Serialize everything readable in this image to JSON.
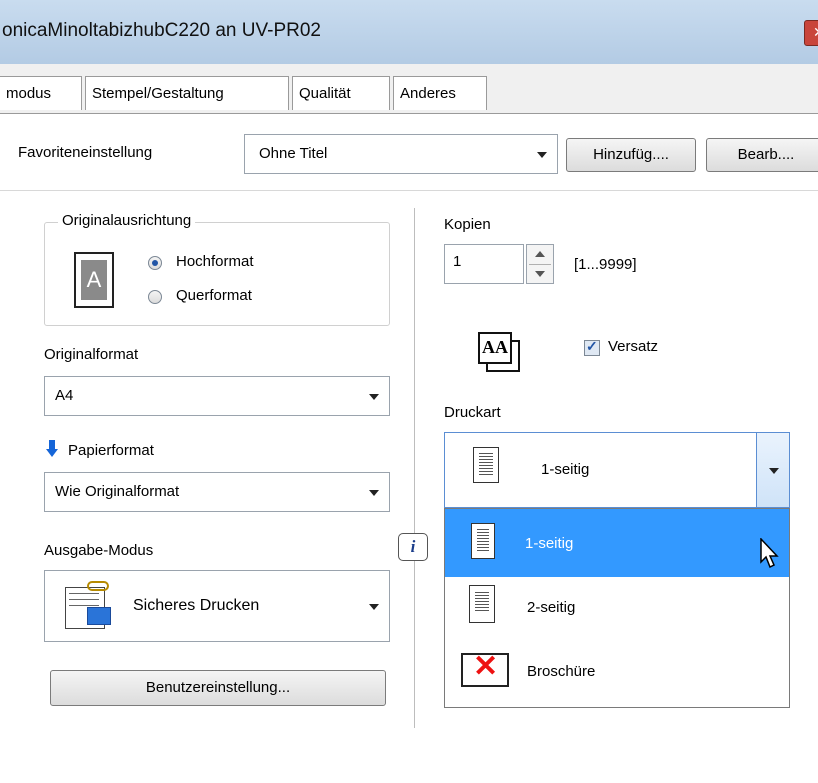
{
  "window": {
    "title": "onicaMinoltabizhubC220 an UV-PR02"
  },
  "tabs": [
    "modus",
    "Stempel/Gestaltung",
    "Qualität",
    "Anderes"
  ],
  "favorites": {
    "label": "Favoriteneinstellung",
    "value": "Ohne Titel",
    "add_button": "Hinzufüg....",
    "edit_button": "Bearb...."
  },
  "orientation": {
    "group_label": "Originalausrichtung",
    "portrait": "Hochformat",
    "landscape": "Querformat",
    "icon_letter": "A"
  },
  "original_format": {
    "label": "Originalformat",
    "value": "A4"
  },
  "paper_format": {
    "label": "Papierformat",
    "value": "Wie Originalformat"
  },
  "output_mode": {
    "label": "Ausgabe-Modus",
    "value": "Sicheres Drucken"
  },
  "user_settings_button": "Benutzereinstellung...",
  "copies": {
    "label": "Kopien",
    "value": "1",
    "range": "[1...9999]"
  },
  "offset": {
    "label": "Versatz",
    "checked": true,
    "icon_text": "AA"
  },
  "print_type": {
    "label": "Druckart",
    "selected": "1-seitig",
    "options": [
      "1-seitig",
      "2-seitig",
      "Broschüre"
    ],
    "info_icon_text": "i"
  },
  "colors": {
    "selection": "#3399ff",
    "accent": "#2155a6"
  }
}
